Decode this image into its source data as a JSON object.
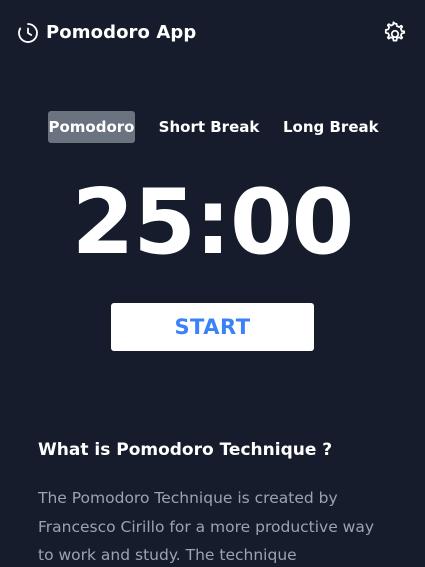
{
  "header": {
    "title": "Pomodoro App",
    "logo_icon": "clock-icon",
    "settings_icon": "gear-icon"
  },
  "tabs": [
    {
      "label": "Pomodoro",
      "active": true
    },
    {
      "label": "Short Break",
      "active": false
    },
    {
      "label": "Long Break",
      "active": false
    }
  ],
  "timer": {
    "display": "25:00"
  },
  "start_button": {
    "label": "START"
  },
  "info": {
    "title": "What is Pomodoro Technique ?",
    "text": "The Pomodoro Technique is created by Francesco Cirillo for a more productive way to work and study. The technique"
  },
  "colors": {
    "background": "#161c2c",
    "active_tab": "#6b7280",
    "accent": "#3b82f6",
    "muted_text": "#9ca3af"
  }
}
